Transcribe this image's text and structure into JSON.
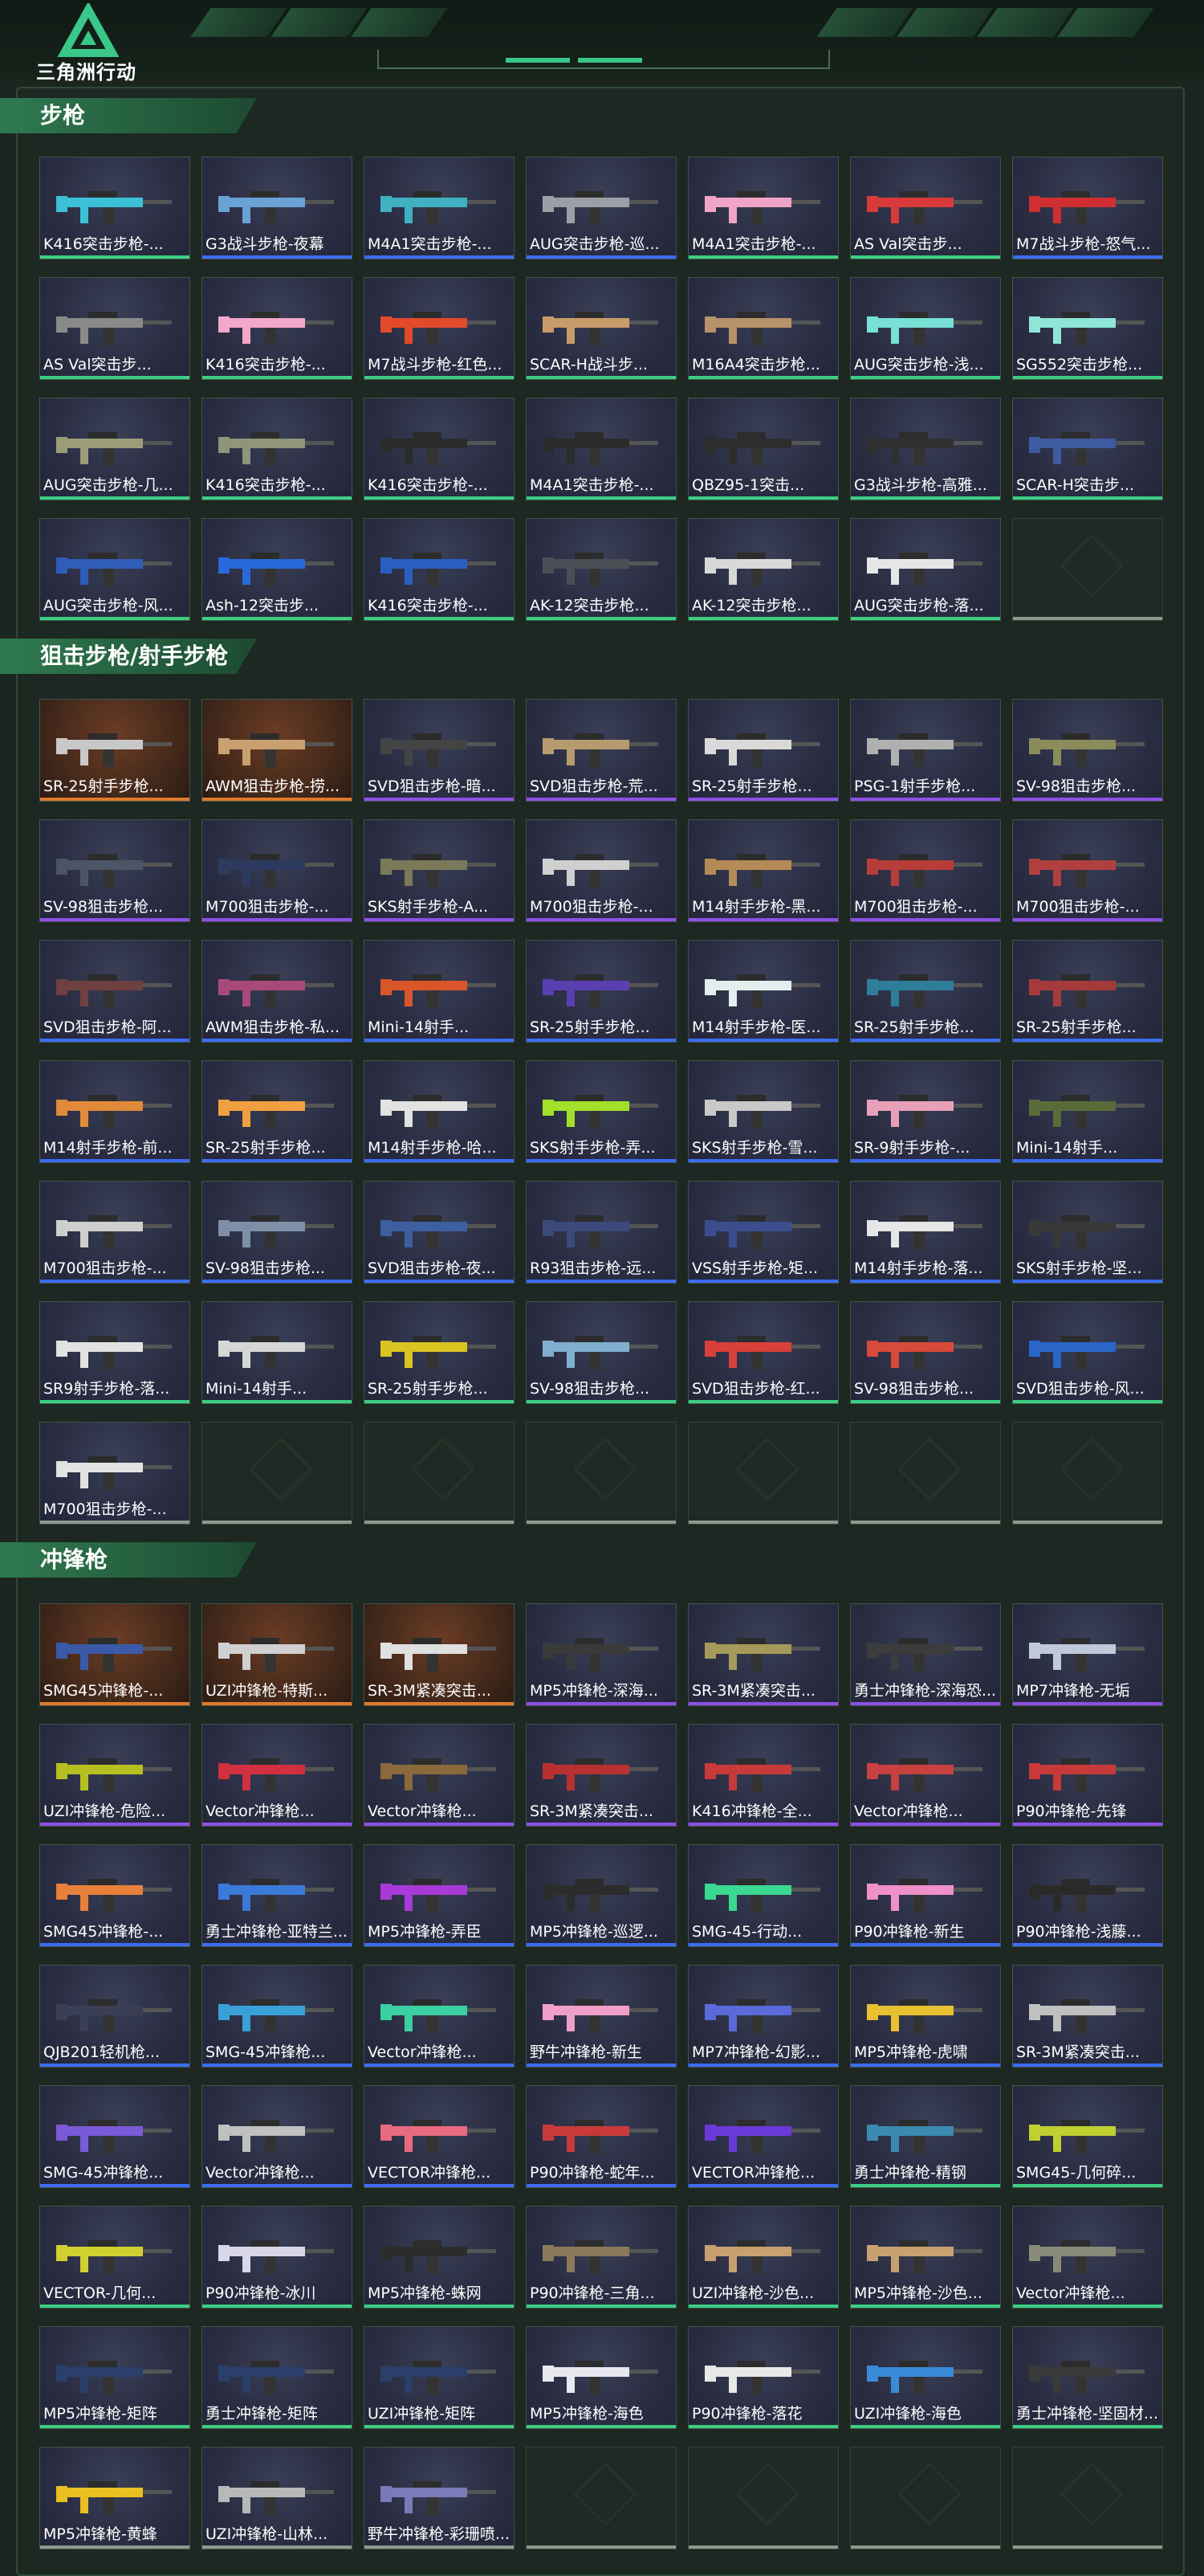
{
  "header": {
    "logo_text": "三角洲行动"
  },
  "sections": [
    {
      "title": "步枪",
      "items": [
        {
          "label": "K416突击步枪-...",
          "rarity": "green",
          "color": "#3cc0d8"
        },
        {
          "label": "G3战斗步枪-夜幕",
          "rarity": "blue",
          "color": "#6aa2d6"
        },
        {
          "label": "M4A1突击步枪-...",
          "rarity": "blue",
          "color": "#3fb1c2"
        },
        {
          "label": "AUG突击步枪-巡...",
          "rarity": "blue",
          "color": "#9aa0a6"
        },
        {
          "label": "M4A1突击步枪-...",
          "rarity": "green",
          "color": "#f0a4c8"
        },
        {
          "label": "AS Val突击步...",
          "rarity": "green",
          "color": "#d83a3a"
        },
        {
          "label": "M7战斗步枪-怒气...",
          "rarity": "blue",
          "color": "#cf2f33"
        },
        {
          "label": "AS Val突击步...",
          "rarity": "green",
          "color": "#8a8a8a"
        },
        {
          "label": "K416突击步枪-...",
          "rarity": "green",
          "color": "#f3a7c9"
        },
        {
          "label": "M7战斗步枪-红色...",
          "rarity": "green",
          "color": "#e24a2a"
        },
        {
          "label": "SCAR-H战斗步...",
          "rarity": "green",
          "color": "#c99b6b"
        },
        {
          "label": "M16A4突击步枪...",
          "rarity": "green",
          "color": "#b8926a"
        },
        {
          "label": "AUG突击步枪-浅...",
          "rarity": "green",
          "color": "#76e1d4"
        },
        {
          "label": "SG552突击步枪...",
          "rarity": "green",
          "color": "#8fe6d7"
        },
        {
          "label": "AUG突击步枪-几...",
          "rarity": "green",
          "color": "#9c9d78"
        },
        {
          "label": "K416突击步枪-...",
          "rarity": "green",
          "color": "#8f947a"
        },
        {
          "label": "K416突击步枪-...",
          "rarity": "green",
          "color": "#2b2b2b"
        },
        {
          "label": "M4A1突击步枪-...",
          "rarity": "green",
          "color": "#2b2b2b"
        },
        {
          "label": "QBZ95-1突击...",
          "rarity": "green",
          "color": "#2d2d2d"
        },
        {
          "label": "G3战斗步枪-高雅...",
          "rarity": "green",
          "color": "#303030"
        },
        {
          "label": "SCAR-H突击步...",
          "rarity": "green",
          "color": "#3e5aa0"
        },
        {
          "label": "AUG突击步枪-风...",
          "rarity": "green",
          "color": "#2f5db8"
        },
        {
          "label": "Ash-12突击步...",
          "rarity": "green",
          "color": "#2a69d9"
        },
        {
          "label": "K416突击步枪-...",
          "rarity": "green",
          "color": "#2a5fbf"
        },
        {
          "label": "AK-12突击步枪...",
          "rarity": "green",
          "color": "#4a4f55"
        },
        {
          "label": "AK-12突击步枪...",
          "rarity": "green",
          "color": "#d8d8d8"
        },
        {
          "label": "AUG突击步枪-落...",
          "rarity": "green",
          "color": "#e6e6e6"
        },
        {
          "label": "",
          "rarity": "gray",
          "empty": true
        }
      ]
    },
    {
      "title": "狙击步枪/射手步枪",
      "items": [
        {
          "label": "SR-25射手步枪...",
          "rarity": "orange",
          "color": "#c8c8c8",
          "gold": true
        },
        {
          "label": "AWM狙击步枪-捞...",
          "rarity": "orange",
          "color": "#c9a070",
          "gold": true
        },
        {
          "label": "SVD狙击步枪-暗...",
          "rarity": "purple",
          "color": "#444"
        },
        {
          "label": "SVD狙击步枪-荒...",
          "rarity": "purple",
          "color": "#b59b6f"
        },
        {
          "label": "SR-25射手步枪...",
          "rarity": "purple",
          "color": "#d9d9d9"
        },
        {
          "label": "PSG-1射手步枪...",
          "rarity": "purple",
          "color": "#b0b0b0"
        },
        {
          "label": "SV-98狙击步枪...",
          "rarity": "purple",
          "color": "#8b8c5c"
        },
        {
          "label": "SV-98狙击步枪...",
          "rarity": "purple",
          "color": "#4c5566"
        },
        {
          "label": "M700狙击步枪-...",
          "rarity": "purple",
          "color": "#2d3a5f"
        },
        {
          "label": "SKS射手步枪-A...",
          "rarity": "purple",
          "color": "#7a7a5a"
        },
        {
          "label": "M700狙击步枪-...",
          "rarity": "purple",
          "color": "#d0d0d0"
        },
        {
          "label": "M14射手步枪-黑...",
          "rarity": "purple",
          "color": "#b48b56"
        },
        {
          "label": "M700狙击步枪-...",
          "rarity": "purple",
          "color": "#b83c38"
        },
        {
          "label": "M700狙击步枪-...",
          "rarity": "purple",
          "color": "#b04040"
        },
        {
          "label": "SVD狙击步枪-阿...",
          "rarity": "blue",
          "color": "#6e4040"
        },
        {
          "label": "AWM狙击步枪-私...",
          "rarity": "blue",
          "color": "#a74a7a"
        },
        {
          "label": "Mini-14射手...",
          "rarity": "blue",
          "color": "#d9562a"
        },
        {
          "label": "SR-25射手步枪...",
          "rarity": "blue",
          "color": "#5a3fb0"
        },
        {
          "label": "M14射手步枪-医...",
          "rarity": "blue",
          "color": "#e3eeee"
        },
        {
          "label": "SR-25射手步枪...",
          "rarity": "blue",
          "color": "#2e7e9a"
        },
        {
          "label": "SR-25射手步枪...",
          "rarity": "blue",
          "color": "#a53a3a"
        },
        {
          "label": "M14射手步枪-前...",
          "rarity": "blue",
          "color": "#e08a3a"
        },
        {
          "label": "SR-25射手步枪...",
          "rarity": "blue",
          "color": "#f0a040"
        },
        {
          "label": "M14射手步枪-哈...",
          "rarity": "blue",
          "color": "#e2e2e2"
        },
        {
          "label": "SKS射手步枪-弄...",
          "rarity": "blue",
          "color": "#a2e02a"
        },
        {
          "label": "SKS射手步枪-雪...",
          "rarity": "blue",
          "color": "#c9c9c9"
        },
        {
          "label": "SR-9射手步枪-...",
          "rarity": "blue",
          "color": "#e8a0b8"
        },
        {
          "label": "Mini-14射手...",
          "rarity": "blue",
          "color": "#5a6b3a"
        },
        {
          "label": "M700狙击步枪-...",
          "rarity": "blue",
          "color": "#cfcfcf"
        },
        {
          "label": "SV-98狙击步枪...",
          "rarity": "blue",
          "color": "#7f8fa8"
        },
        {
          "label": "SVD狙击步枪-夜...",
          "rarity": "blue",
          "color": "#3c5f9f"
        },
        {
          "label": "R93狙击步枪-远...",
          "rarity": "blue",
          "color": "#3a4a7a"
        },
        {
          "label": "VSS射手步枪-矩...",
          "rarity": "blue",
          "color": "#3b4d8f"
        },
        {
          "label": "M14射手步枪-落...",
          "rarity": "blue",
          "color": "#e6e6e6"
        },
        {
          "label": "SKS射手步枪-坚...",
          "rarity": "blue",
          "color": "#383838"
        },
        {
          "label": "SR9射手步枪-落...",
          "rarity": "green",
          "color": "#e2e2e2"
        },
        {
          "label": "Mini-14射手...",
          "rarity": "green",
          "color": "#d6d6d6"
        },
        {
          "label": "SR-25射手步枪...",
          "rarity": "green",
          "color": "#d8c520"
        },
        {
          "label": "SV-98狙击步枪...",
          "rarity": "green",
          "color": "#7fb0d0"
        },
        {
          "label": "SVD狙击步枪-红...",
          "rarity": "green",
          "color": "#d8403a"
        },
        {
          "label": "SV-98狙击步枪...",
          "rarity": "green",
          "color": "#d84a3a"
        },
        {
          "label": "SVD狙击步枪-风...",
          "rarity": "green",
          "color": "#2a66c8"
        },
        {
          "label": "M700狙击步枪-...",
          "rarity": "gray",
          "color": "#e2e2e2"
        },
        {
          "label": "",
          "rarity": "gray",
          "empty": true
        },
        {
          "label": "",
          "rarity": "gray",
          "empty": true
        },
        {
          "label": "",
          "rarity": "gray",
          "empty": true
        },
        {
          "label": "",
          "rarity": "gray",
          "empty": true
        },
        {
          "label": "",
          "rarity": "gray",
          "empty": true
        },
        {
          "label": "",
          "rarity": "gray",
          "empty": true
        }
      ]
    },
    {
      "title": "冲锋枪",
      "items": [
        {
          "label": "SMG45冲锋枪-...",
          "rarity": "orange",
          "color": "#3a5aa8",
          "gold": true
        },
        {
          "label": "UZI冲锋枪-特斯...",
          "rarity": "orange",
          "color": "#d0d0d0",
          "gold": true
        },
        {
          "label": "SR-3M紧凑突击...",
          "rarity": "orange",
          "color": "#e0e0e0",
          "gold": true
        },
        {
          "label": "MP5冲锋枪-深海...",
          "rarity": "purple",
          "color": "#3a3a3a"
        },
        {
          "label": "SR-3M紧凑突击...",
          "rarity": "purple",
          "color": "#a59a5a"
        },
        {
          "label": "勇士冲锋枪-深海恐...",
          "rarity": "purple",
          "color": "#3c3c3c"
        },
        {
          "label": "MP7冲锋枪-无垢",
          "rarity": "purple",
          "color": "#bfc9d9"
        },
        {
          "label": "UZI冲锋枪-危险...",
          "rarity": "purple",
          "color": "#b5c020"
        },
        {
          "label": "Vector冲锋枪...",
          "rarity": "purple",
          "color": "#d03040"
        },
        {
          "label": "Vector冲锋枪...",
          "rarity": "purple",
          "color": "#8a6a3a"
        },
        {
          "label": "SR-3M紧凑突击...",
          "rarity": "purple",
          "color": "#b83030"
        },
        {
          "label": "K416冲锋枪-全...",
          "rarity": "purple",
          "color": "#c83a3a"
        },
        {
          "label": "Vector冲锋枪...",
          "rarity": "purple",
          "color": "#c84040"
        },
        {
          "label": "P90冲锋枪-先锋",
          "rarity": "purple",
          "color": "#c83a3a"
        },
        {
          "label": "SMG45冲锋枪-...",
          "rarity": "blue",
          "color": "#e8803a"
        },
        {
          "label": "勇士冲锋枪-亚特兰...",
          "rarity": "blue",
          "color": "#3a7ad8"
        },
        {
          "label": "MP5冲锋枪-弄臣",
          "rarity": "blue",
          "color": "#a83ad8"
        },
        {
          "label": "MP5冲锋枪-巡逻...",
          "rarity": "blue",
          "color": "#2c2c2c"
        },
        {
          "label": "SMG-45-行动...",
          "rarity": "blue",
          "color": "#3ad890"
        },
        {
          "label": "P90冲锋枪-新生",
          "rarity": "blue",
          "color": "#f090c8"
        },
        {
          "label": "P90冲锋枪-浅藤...",
          "rarity": "blue",
          "color": "#2a2a2a"
        },
        {
          "label": "QJB201轻机枪...",
          "rarity": "blue",
          "color": "#3a3f55"
        },
        {
          "label": "SMG-45冲锋枪...",
          "rarity": "blue",
          "color": "#3aa0d8"
        },
        {
          "label": "Vector冲锋枪...",
          "rarity": "blue",
          "color": "#3ad0a0"
        },
        {
          "label": "野牛冲锋枪-新生",
          "rarity": "blue",
          "color": "#f0a0c8"
        },
        {
          "label": "MP7冲锋枪-幻影...",
          "rarity": "blue",
          "color": "#5a6ad8"
        },
        {
          "label": "MP5冲锋枪-虎啸",
          "rarity": "blue",
          "color": "#e8c030"
        },
        {
          "label": "SR-3M紧凑突击...",
          "rarity": "blue",
          "color": "#c0c0c0"
        },
        {
          "label": "SMG-45冲锋枪...",
          "rarity": "blue",
          "color": "#7a5ad8"
        },
        {
          "label": "Vector冲锋枪...",
          "rarity": "blue",
          "color": "#c0c0c0"
        },
        {
          "label": "VECTOR冲锋枪...",
          "rarity": "blue",
          "color": "#e86a80"
        },
        {
          "label": "P90冲锋枪-蛇年...",
          "rarity": "blue",
          "color": "#c83a3a"
        },
        {
          "label": "VECTOR冲锋枪...",
          "rarity": "blue",
          "color": "#6a3ad8"
        },
        {
          "label": "勇士冲锋枪-精钢",
          "rarity": "green",
          "color": "#3a8ab0"
        },
        {
          "label": "SMG45-几何碎...",
          "rarity": "green",
          "color": "#c0d030"
        },
        {
          "label": "VECTOR-几何...",
          "rarity": "green",
          "color": "#d0d030"
        },
        {
          "label": "P90冲锋枪-冰川",
          "rarity": "green",
          "color": "#d8d8e8"
        },
        {
          "label": "MP5冲锋枪-蛛网",
          "rarity": "green",
          "color": "#2c2c2c"
        },
        {
          "label": "P90冲锋枪-三角...",
          "rarity": "green",
          "color": "#8a7a5a"
        },
        {
          "label": "UZI冲锋枪-沙色...",
          "rarity": "green",
          "color": "#c8a070"
        },
        {
          "label": "MP5冲锋枪-沙色...",
          "rarity": "green",
          "color": "#c8a070"
        },
        {
          "label": "Vector冲锋枪...",
          "rarity": "green",
          "color": "#8a8a7a"
        },
        {
          "label": "MP5冲锋枪-矩阵",
          "rarity": "green",
          "color": "#2a3f6a"
        },
        {
          "label": "勇士冲锋枪-矩阵",
          "rarity": "green",
          "color": "#2a3f6a"
        },
        {
          "label": "UZI冲锋枪-矩阵",
          "rarity": "green",
          "color": "#2a3f6a"
        },
        {
          "label": "MP5冲锋枪-海色",
          "rarity": "green",
          "color": "#e8e8f0"
        },
        {
          "label": "P90冲锋枪-落花",
          "rarity": "green",
          "color": "#e8e8e8"
        },
        {
          "label": "UZI冲锋枪-海色",
          "rarity": "green",
          "color": "#3a8ad8"
        },
        {
          "label": "勇士冲锋枪-坚固材...",
          "rarity": "green",
          "color": "#3a3a3a"
        },
        {
          "label": "MP5冲锋枪-黄蜂",
          "rarity": "gray",
          "color": "#e8c020"
        },
        {
          "label": "UZI冲锋枪-山林...",
          "rarity": "gray",
          "color": "#b8b8b8"
        },
        {
          "label": "野牛冲锋枪-彩珊喷...",
          "rarity": "gray",
          "color": "#7a7ab8"
        },
        {
          "label": "",
          "rarity": "gray",
          "empty": true
        },
        {
          "label": "",
          "rarity": "gray",
          "empty": true
        },
        {
          "label": "",
          "rarity": "gray",
          "empty": true
        },
        {
          "label": "",
          "rarity": "gray",
          "empty": true
        }
      ]
    }
  ]
}
